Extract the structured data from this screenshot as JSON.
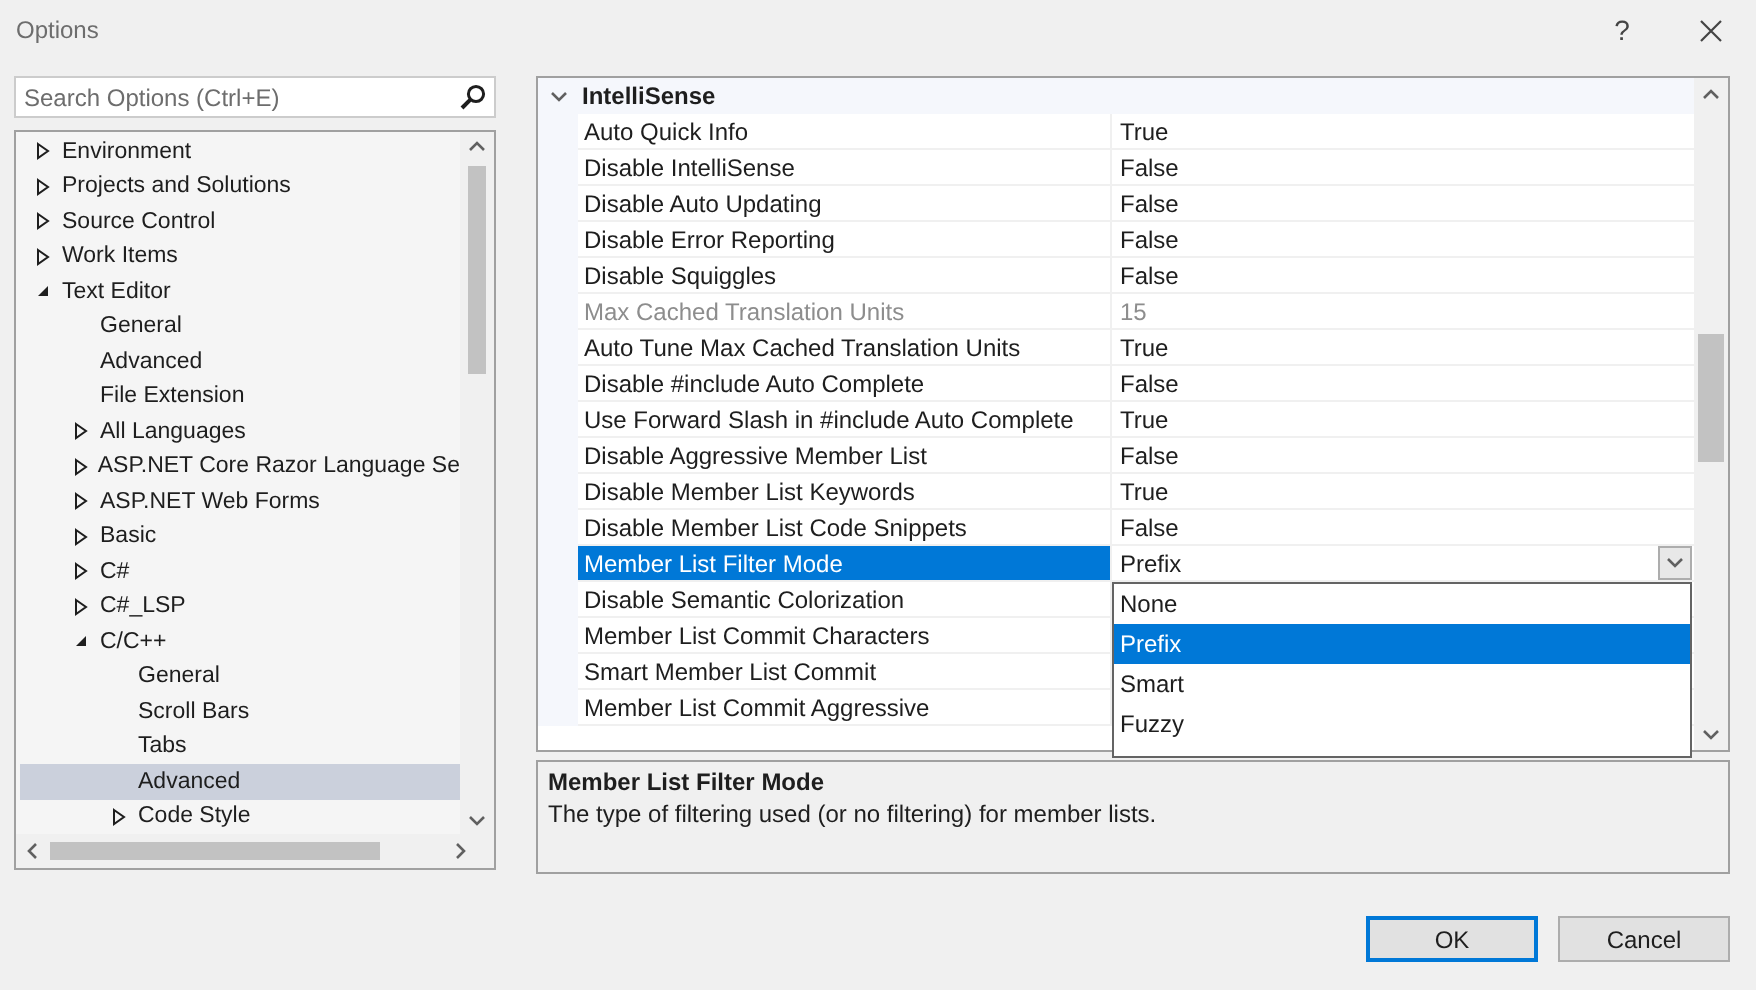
{
  "window": {
    "title": "Options",
    "help": "?"
  },
  "search": {
    "placeholder": "Search Options (Ctrl+E)"
  },
  "tree": [
    {
      "label": "Environment",
      "expanded": false,
      "selected": false
    },
    {
      "label": "Projects and Solutions",
      "expanded": false,
      "selected": false
    },
    {
      "label": "Source Control",
      "expanded": false,
      "selected": false
    },
    {
      "label": "Work Items",
      "expanded": false,
      "selected": false
    },
    {
      "label": "Text Editor",
      "expanded": true,
      "selected": false,
      "children": [
        {
          "label": "General",
          "selected": false
        },
        {
          "label": "Advanced",
          "selected": false
        },
        {
          "label": "File Extension",
          "selected": false
        },
        {
          "label": "All Languages",
          "expanded": false,
          "selected": false
        },
        {
          "label": "ASP.NET Core Razor Language Se",
          "expanded": false,
          "selected": false
        },
        {
          "label": "ASP.NET Web Forms",
          "expanded": false,
          "selected": false
        },
        {
          "label": "Basic",
          "expanded": false,
          "selected": false
        },
        {
          "label": "C#",
          "expanded": false,
          "selected": false
        },
        {
          "label": "C#_LSP",
          "expanded": false,
          "selected": false
        },
        {
          "label": "C/C++",
          "expanded": true,
          "selected": false,
          "children": [
            {
              "label": "General",
              "selected": false
            },
            {
              "label": "Scroll Bars",
              "selected": false
            },
            {
              "label": "Tabs",
              "selected": false
            },
            {
              "label": "Advanced",
              "selected": true
            },
            {
              "label": "Code Style",
              "expanded": false,
              "selected": false
            }
          ]
        }
      ]
    }
  ],
  "grid": {
    "category": "IntelliSense",
    "expanded": true,
    "rows": [
      {
        "name": "Auto Quick Info",
        "value": "True",
        "disabled": false,
        "selected": false
      },
      {
        "name": "Disable IntelliSense",
        "value": "False",
        "disabled": false,
        "selected": false
      },
      {
        "name": "Disable Auto Updating",
        "value": "False",
        "disabled": false,
        "selected": false
      },
      {
        "name": "Disable Error Reporting",
        "value": "False",
        "disabled": false,
        "selected": false
      },
      {
        "name": "Disable Squiggles",
        "value": "False",
        "disabled": false,
        "selected": false
      },
      {
        "name": "Max Cached Translation Units",
        "value": "15",
        "disabled": true,
        "selected": false
      },
      {
        "name": "Auto Tune Max Cached Translation Units",
        "value": "True",
        "disabled": false,
        "selected": false
      },
      {
        "name": "Disable #include Auto Complete",
        "value": "False",
        "disabled": false,
        "selected": false
      },
      {
        "name": "Use Forward Slash in #include Auto Complete",
        "value": "True",
        "disabled": false,
        "selected": false
      },
      {
        "name": "Disable Aggressive Member List",
        "value": "False",
        "disabled": false,
        "selected": false
      },
      {
        "name": "Disable Member List Keywords",
        "value": "True",
        "disabled": false,
        "selected": false
      },
      {
        "name": "Disable Member List Code Snippets",
        "value": "False",
        "disabled": false,
        "selected": false
      },
      {
        "name": "Member List Filter Mode",
        "value": "Prefix",
        "disabled": false,
        "selected": true,
        "kind": "dropdown",
        "options": [
          {
            "label": "None",
            "selected": false
          },
          {
            "label": "Prefix",
            "selected": true
          },
          {
            "label": "Smart",
            "selected": false
          },
          {
            "label": "Fuzzy",
            "selected": false
          }
        ]
      },
      {
        "name": "Disable Semantic Colorization",
        "disabled": false,
        "selected": false
      },
      {
        "name": "Member List Commit Characters",
        "disabled": false,
        "selected": false
      },
      {
        "name": "Smart Member List Commit",
        "disabled": false,
        "selected": false
      },
      {
        "name": "Member List Commit Aggressive",
        "disabled": false,
        "selected": false
      }
    ]
  },
  "description": {
    "title": "Member List Filter Mode",
    "text": "The type of filtering used (or no filtering) for member lists."
  },
  "buttons": [
    {
      "label": "OK",
      "kind": "primary"
    },
    {
      "label": "Cancel",
      "kind": "normal"
    }
  ]
}
